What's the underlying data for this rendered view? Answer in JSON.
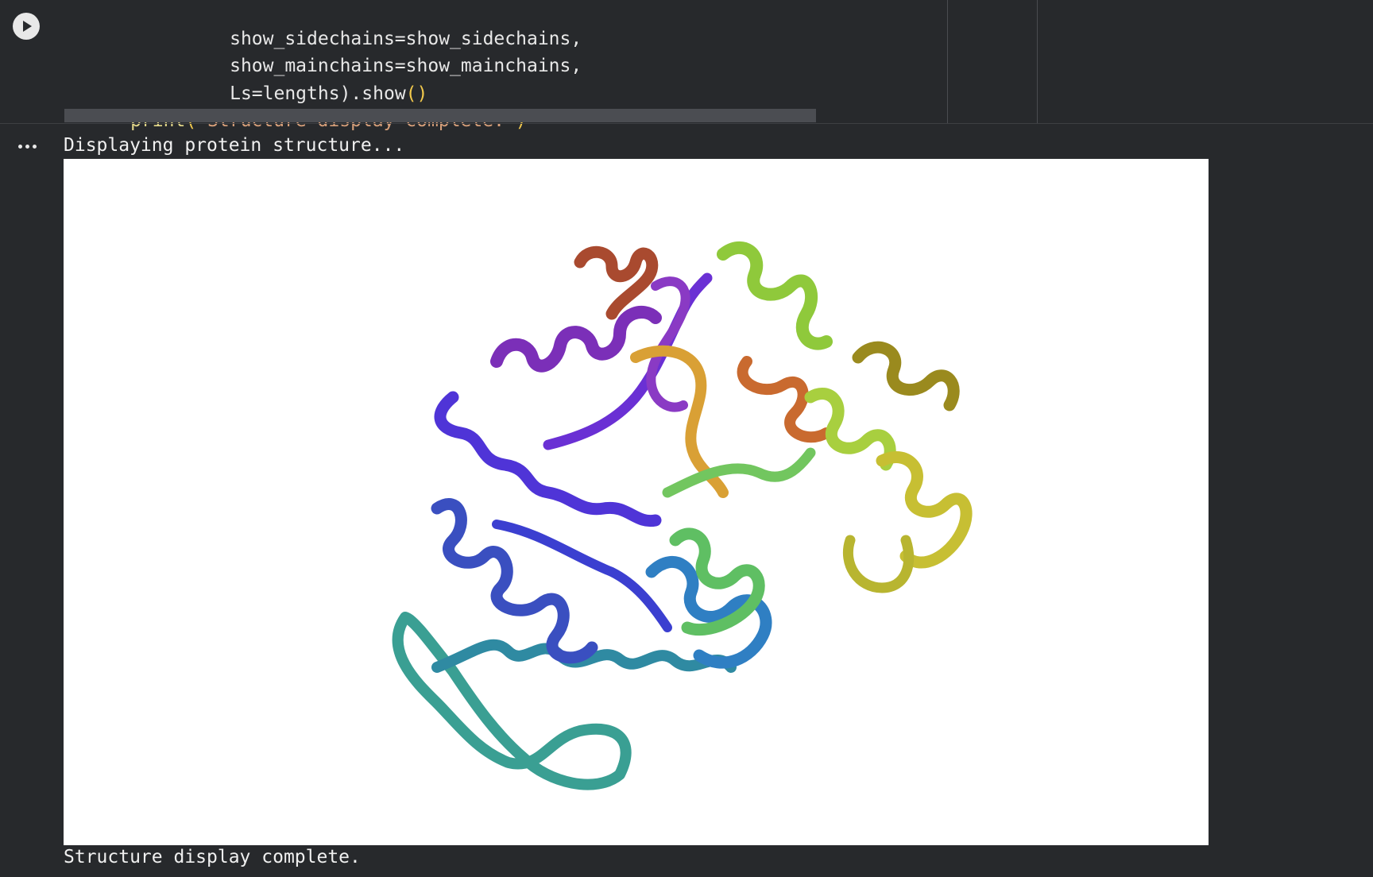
{
  "code": {
    "line1": "show_sidechains=show_sidechains,",
    "line2": "show_mainchains=show_mainchains,",
    "line3_a": "Ls=lengths",
    "line3_b": ").show",
    "line3_c": "()",
    "line4_func": "print",
    "line4_open": "(",
    "line4_str": "\"Structure display complete.\"",
    "line4_close": ")"
  },
  "output": {
    "line1": "Displaying protein structure...",
    "line2": "Structure display complete."
  },
  "icons": {
    "run": "play-icon",
    "menu": "more-horizontal-icon"
  },
  "colors": {
    "background": "#27292c",
    "viewer_background": "#ffffff",
    "function": "#e5d98a",
    "string": "#d8a07a",
    "bracket": "#f2c94c",
    "structure_rainbow": [
      "#7b2fb8",
      "#4f34d7",
      "#3a4fc0",
      "#2f7fc3",
      "#39a6a0",
      "#72c65f",
      "#a8cf3f",
      "#c7bf33",
      "#d9a035",
      "#c96a2f",
      "#a94a2f"
    ]
  }
}
